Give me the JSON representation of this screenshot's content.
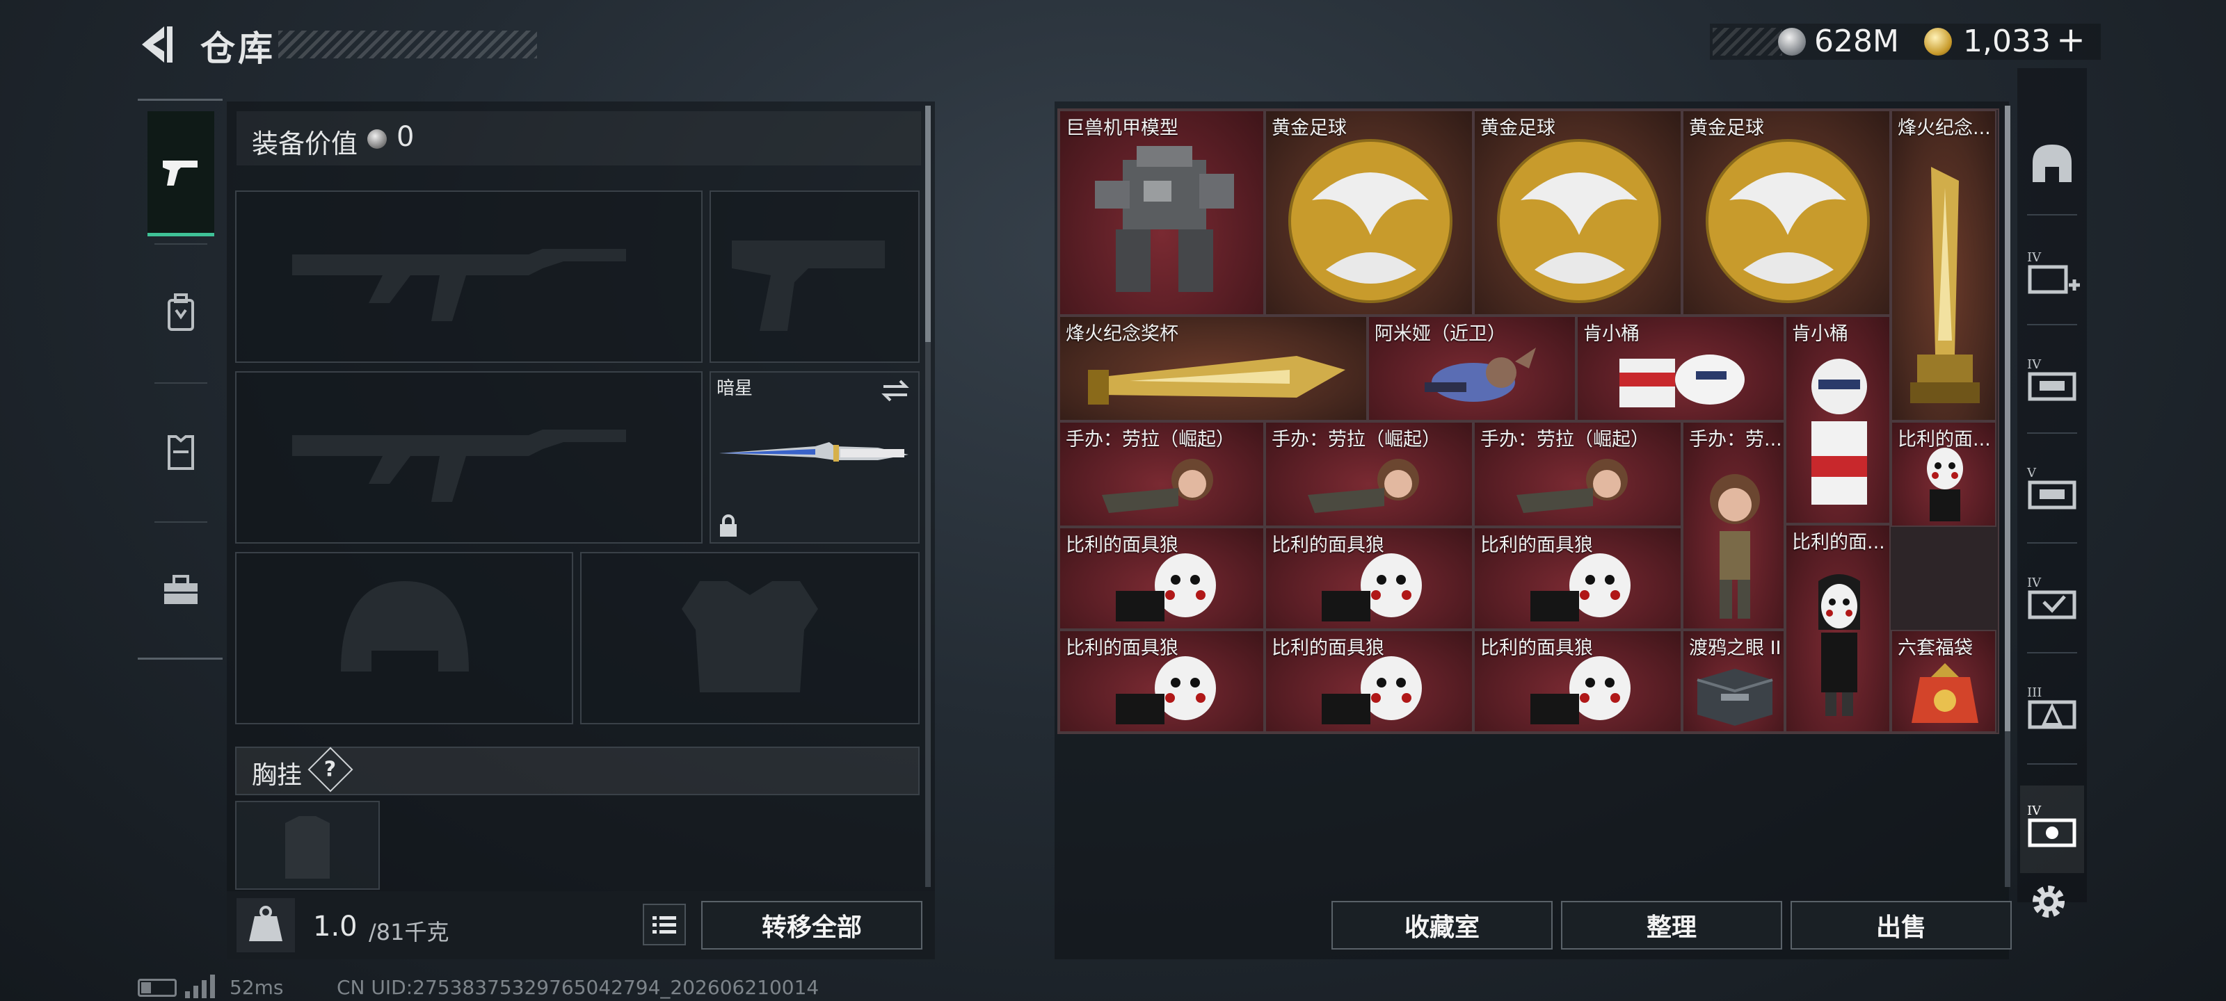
{
  "header": {
    "title": "仓库",
    "back_icon": "back-arrow-icon"
  },
  "currency": {
    "silver_icon": "silver-coin-icon",
    "silver": "628M",
    "gold_icon": "gold-coin-icon",
    "gold": "1,033",
    "add_icon": "plus-icon",
    "add_label": "+"
  },
  "left_tabs": [
    {
      "icon": "pistol-icon",
      "selected": true
    },
    {
      "icon": "backpack-icon",
      "selected": false
    },
    {
      "icon": "vest-icon",
      "selected": false
    },
    {
      "icon": "toolbox-icon",
      "selected": false
    }
  ],
  "equipment": {
    "value_label": "装备价值",
    "value": "0",
    "melee_name": "暗星",
    "chest_label": "胸挂",
    "chest_help": "?",
    "weight_value": "1.0",
    "weight_unit": "/81千克",
    "transfer_all_label": "转移全部"
  },
  "storage": {
    "items": [
      {
        "name": "巨兽机甲模型",
        "art": "mech"
      },
      {
        "name": "黄金足球",
        "art": "ball"
      },
      {
        "name": "黄金足球",
        "art": "ball"
      },
      {
        "name": "黄金足球",
        "art": "ball"
      },
      {
        "name": "烽火纪念...",
        "art": "trophy"
      },
      {
        "name": "烽火纪念奖杯",
        "art": "trophy-h"
      },
      {
        "name": "阿米娅（近卫）",
        "art": "figure"
      },
      {
        "name": "肯小桶",
        "art": "bucket"
      },
      {
        "name": "肯小桶",
        "art": "colonel"
      },
      {
        "name": "手办：劳拉（崛起）",
        "art": "lara-lie"
      },
      {
        "name": "手办：劳拉（崛起）",
        "art": "lara-lie"
      },
      {
        "name": "手办：劳拉（崛起）",
        "art": "lara-lie"
      },
      {
        "name": "手办：劳...",
        "art": "lara-stand"
      },
      {
        "name": "比利的面...",
        "art": "billy-stand"
      },
      {
        "name": "比利的面具狼",
        "art": "billy"
      },
      {
        "name": "比利的面具狼",
        "art": "billy"
      },
      {
        "name": "比利的面具狼",
        "art": "billy"
      },
      {
        "name": "比利的面...",
        "art": "billy-stand"
      },
      {
        "name": "比利的面具狼",
        "art": "billy"
      },
      {
        "name": "比利的面具狼",
        "art": "billy"
      },
      {
        "name": "比利的面具狼",
        "art": "billy"
      },
      {
        "name": "渡鸦之眼 II",
        "art": "case"
      },
      {
        "name": "六套福袋",
        "art": "bag"
      }
    ],
    "buttons": {
      "collection": "收藏室",
      "sort": "整理",
      "sell": "出售"
    }
  },
  "right_sidebar": [
    {
      "icon": "helmet-tier-icon"
    },
    {
      "icon": "iv-add-storage-icon"
    },
    {
      "icon": "iv-storage-1-icon"
    },
    {
      "icon": "v-storage-icon"
    },
    {
      "icon": "iv-storage-2-icon"
    },
    {
      "icon": "iii-storage-icon"
    },
    {
      "icon": "iv-storage-selected-icon"
    }
  ],
  "status": {
    "ping": "52ms",
    "uid": "CN UID:27538375329765042794_202606210014"
  }
}
